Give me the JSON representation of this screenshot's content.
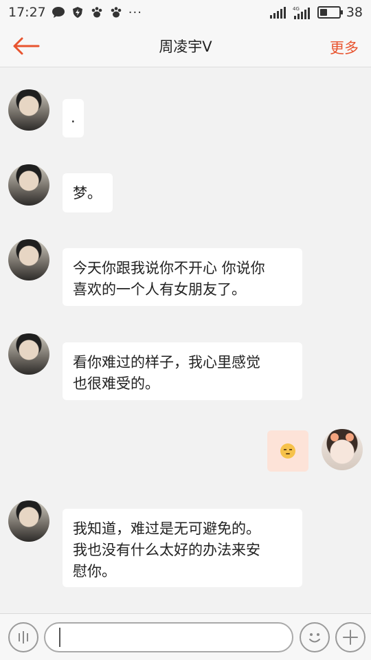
{
  "status_bar": {
    "time": "17:27",
    "battery": "38",
    "battery_level": 0.38,
    "icons": [
      "chat-bubble-icon",
      "shield-bolt-icon",
      "paw-icon",
      "paw-icon",
      "more-dots-icon",
      "wifi-icon",
      "4g-signal-icon",
      "battery-icon"
    ],
    "more": "···"
  },
  "header": {
    "title": "周凌宇V",
    "back_icon": "back-arrow-icon",
    "more_label": "更多"
  },
  "messages": [
    {
      "side": "left",
      "text": "."
    },
    {
      "side": "left",
      "text": "梦。"
    },
    {
      "side": "left",
      "lines": [
        "今天你跟我说你不开心 你说你",
        "喜欢的一个人有女朋友了。"
      ]
    },
    {
      "side": "left",
      "lines": [
        "看你难过的样子，我心里感觉",
        "也很难受的。"
      ]
    },
    {
      "side": "right",
      "emoji": "pensive-face-icon"
    },
    {
      "side": "left",
      "lines": [
        "我知道，难过是无可避免的。",
        "我也没有什么太好的办法来安",
        "慰你。"
      ]
    }
  ],
  "input_bar": {
    "voice_icon": "voice-wave-icon",
    "text_value": "",
    "emoji_icon": "smiley-icon",
    "plus_icon": "plus-icon"
  },
  "colors": {
    "accent": "#e8542f",
    "background": "#f2f2f2",
    "bubble_left": "#ffffff",
    "bubble_right": "#fde3d8"
  }
}
